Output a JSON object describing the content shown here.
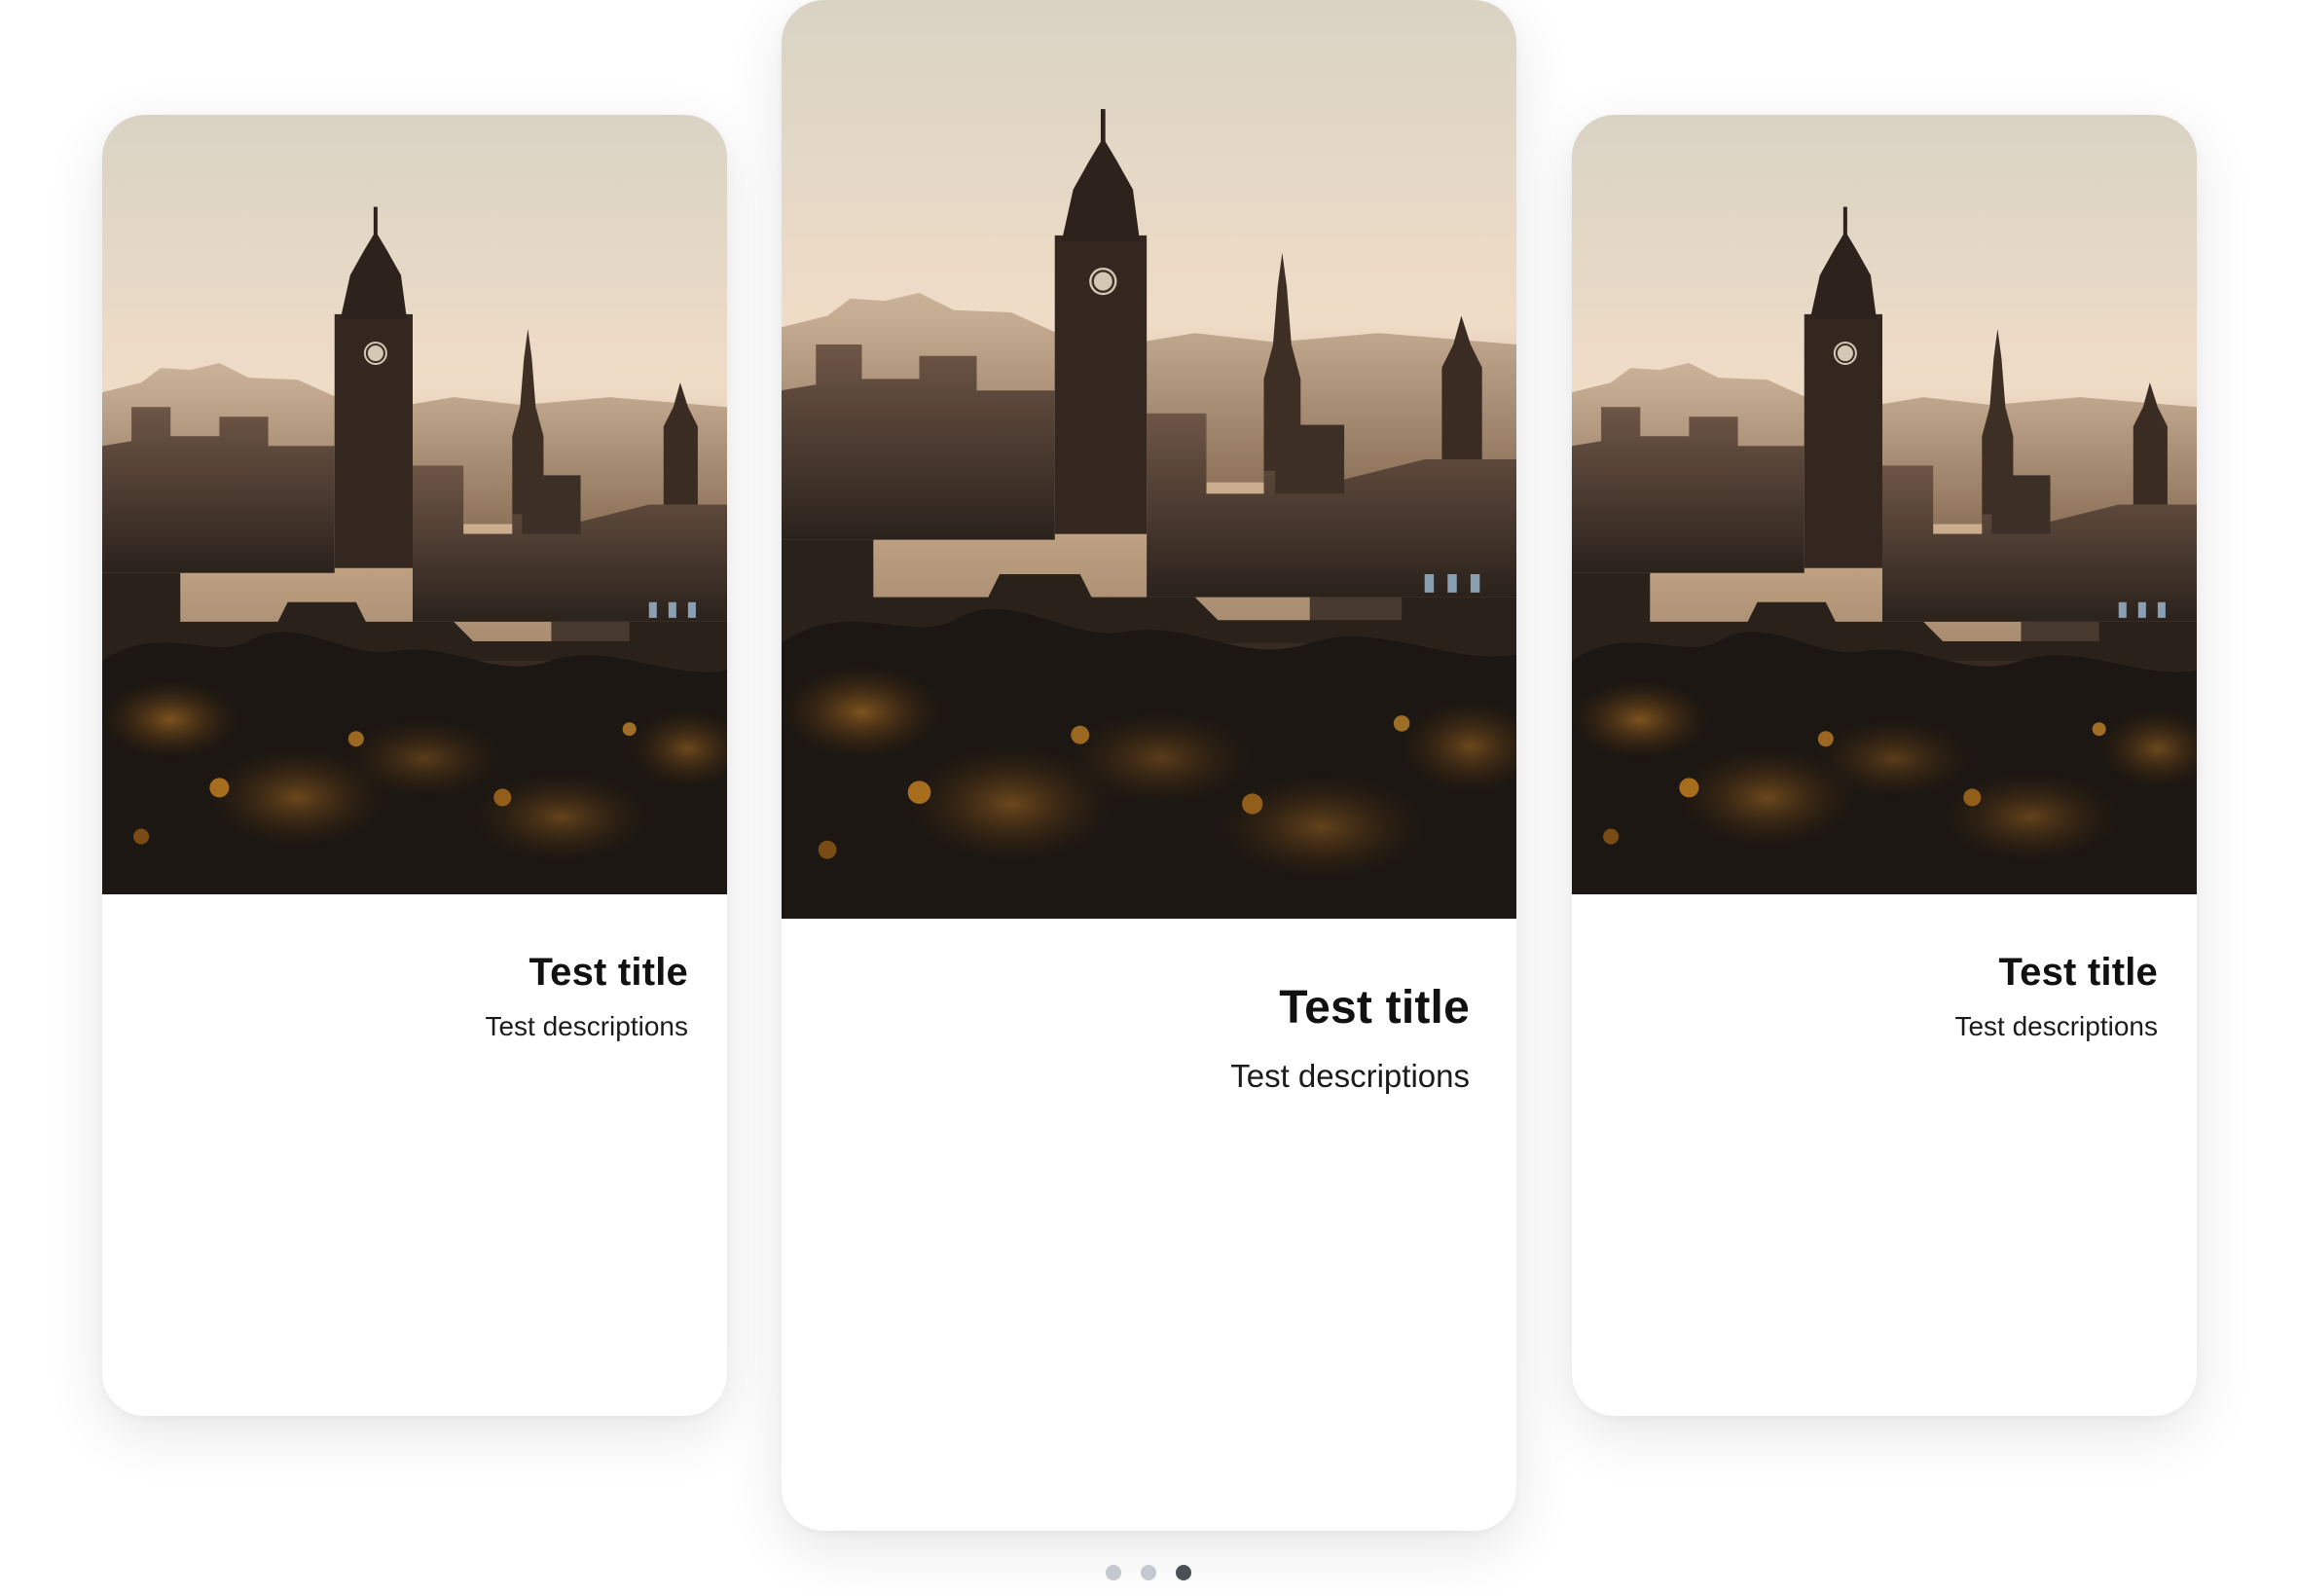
{
  "carousel": {
    "cards": [
      {
        "title": "Test title",
        "description": "Test descriptions",
        "image_icon": "city-skyline-image"
      },
      {
        "title": "Test title",
        "description": "Test descriptions",
        "image_icon": "city-skyline-image"
      },
      {
        "title": "Test title",
        "description": "Test descriptions",
        "image_icon": "city-skyline-image"
      }
    ],
    "pagination": {
      "count": 3,
      "active_index": 2
    }
  },
  "colors": {
    "sky_top": "#ddd6c8",
    "sky_glow": "#efdcc6",
    "silhouette": "#2a211b",
    "foliage_warm": "#b8701f",
    "dot_inactive": "#c4c8d0",
    "dot_active": "#4b5058"
  }
}
